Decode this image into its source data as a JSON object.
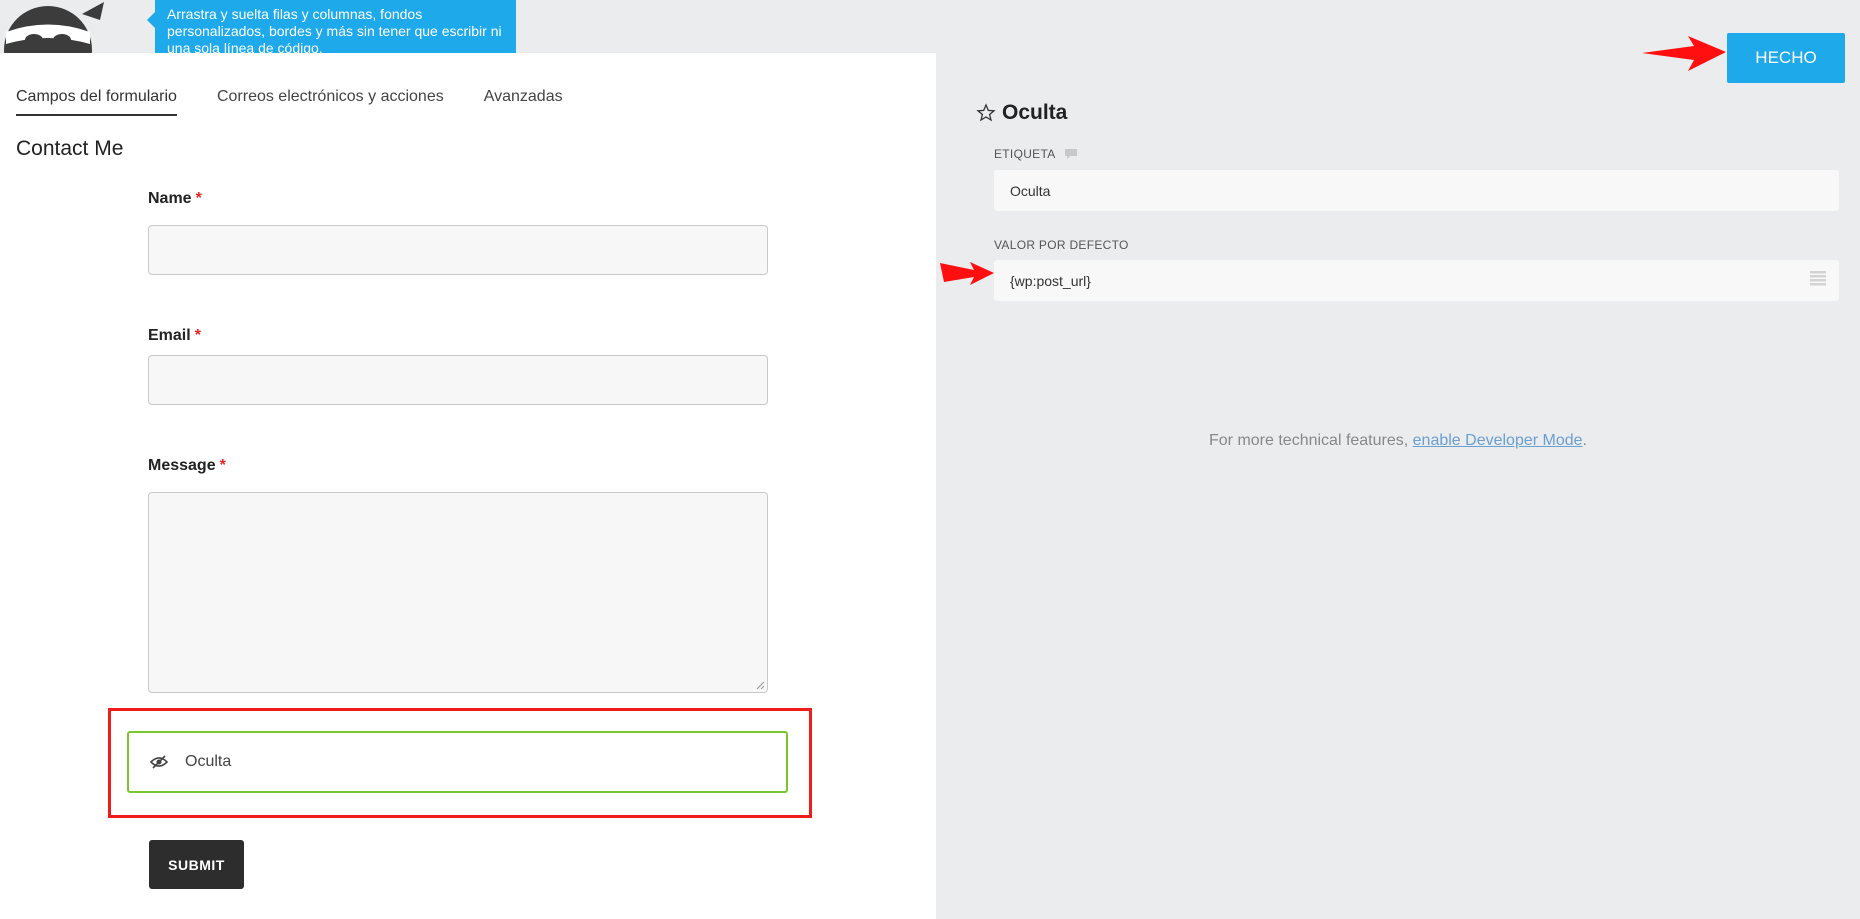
{
  "tooltip": {
    "text": "Arrastra y suelta filas y columnas, fondos personalizados, bordes y más sin tener que escribir ni una sola línea de código."
  },
  "tabs": [
    {
      "label": "Campos del formulario",
      "active": true
    },
    {
      "label": "Correos electrónicos y acciones",
      "active": false
    },
    {
      "label": "Avanzadas",
      "active": false
    }
  ],
  "form": {
    "title": "Contact Me",
    "required_marker": "*",
    "fields": {
      "name": {
        "label": "Name"
      },
      "email": {
        "label": "Email"
      },
      "message": {
        "label": "Message"
      },
      "hidden": {
        "label": "Oculta"
      }
    },
    "submit_label": "SUBMIT"
  },
  "settings": {
    "done_label": "HECHO",
    "title": "Oculta",
    "label_heading": "ETIQUETA",
    "label_value": "Oculta",
    "default_heading": "VALOR POR DEFECTO",
    "default_value": "{wp:post_url}",
    "dev_note_prefix": "For more technical features, ",
    "dev_note_link": "enable Developer Mode",
    "dev_note_suffix": "."
  },
  "colors": {
    "accent": "#1ea9ea",
    "highlight_red": "#ef1c1c",
    "active_field_green": "#7bc62d",
    "required_red": "#ee2222"
  },
  "icons": [
    "ninja-logo",
    "star-icon",
    "comment-icon",
    "eye-slash-icon",
    "merge-tags-icon",
    "arrow-icon"
  ]
}
